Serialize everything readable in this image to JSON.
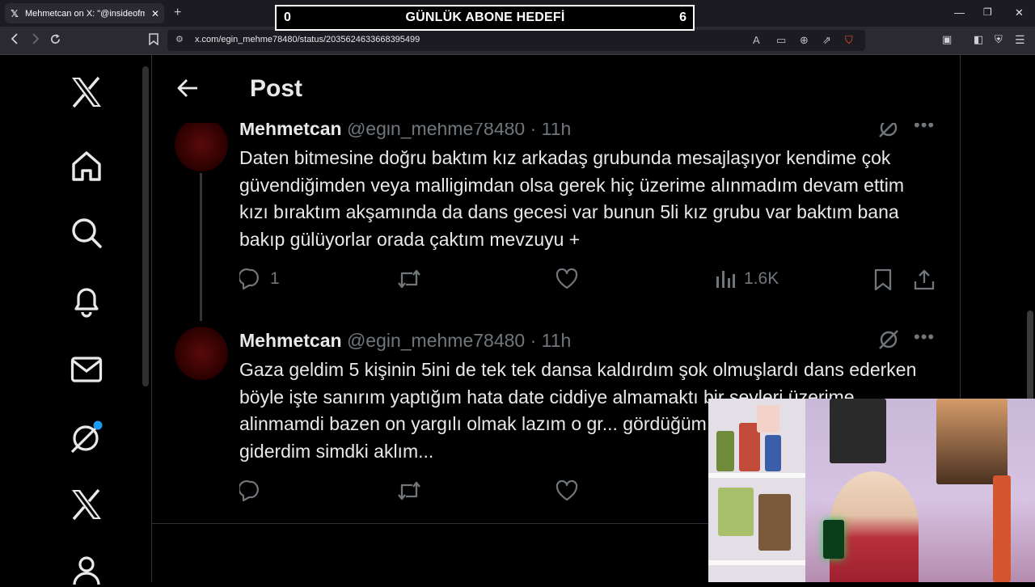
{
  "browser": {
    "tab_title": "Mehmetcan on X: \"@insideofmy",
    "tab_close": "✕",
    "new_tab": "+",
    "url": "x.com/egin_mehme78480/status/2035624633668395499"
  },
  "overlay": {
    "left_number": "0",
    "title": "GÜNLÜK ABONE HEDEFİ",
    "right_number": "6"
  },
  "nav": {
    "items": [
      "x-logo",
      "home",
      "explore",
      "notifications",
      "messages",
      "grok",
      "premium",
      "profile"
    ]
  },
  "header": {
    "title": "Post"
  },
  "tweets": [
    {
      "name": "Mehmetcan",
      "handle": "@egin_mehme78480 · 11h",
      "text": "Daten bitmesine doğru baktım kız arkadaş grubunda mesajlaşıyor kendime çok güvendiğimden veya malligimdan  olsa gerek hiç üzerime alınmadım devam ettim kızı bıraktım akşamında da dans gecesi var bunun 5li kız grubu var baktım bana bakıp gülüyorlar orada çaktım mevzuyu +",
      "replies": "1",
      "views": "1.6K"
    },
    {
      "name": "Mehmetcan",
      "handle": "@egin_mehme78480 · 11h",
      "text": "Gaza geldim 5 kişinin 5ini de tek tek dansa kaldırdım şok olmuşlardı dans ederken böyle işte sanırım yaptığım hata date ciddiye almamaktı bir şeyleri üzerime alinmamdi bazen on yargılı olmak lazım o gr... gördüğüm an kızı orada bırakıp giderdim simdki aklım..."
    }
  ],
  "colors": {
    "background": "#000000",
    "text": "#e7e9ea",
    "muted": "#71767b",
    "notification_dot": "#1d9bf0"
  }
}
